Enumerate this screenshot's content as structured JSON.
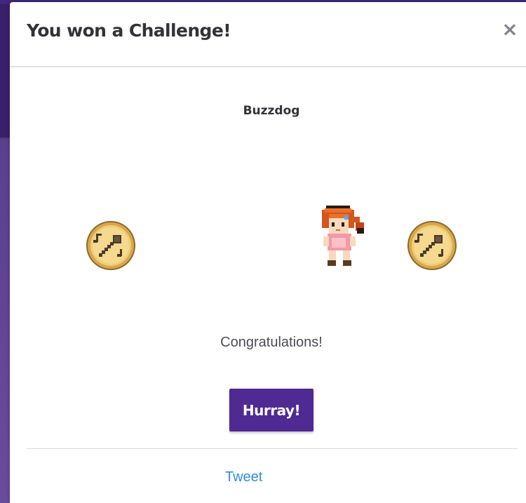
{
  "modal": {
    "title": "You won a Challenge!",
    "close_label": "×",
    "challenge_name": "Buzzdog",
    "message": "Congratulations!",
    "primary_button_label": "Hurray!",
    "tweet_label": "Tweet"
  },
  "icons": {
    "medal": "challenge-medal-microphone-icon",
    "avatar": "pixel-avatar-character",
    "close": "close-icon"
  },
  "colors": {
    "accent": "#4f2a93",
    "link": "#2e8ce6",
    "medal_gold": "#e9c26a",
    "backdrop": "#3a1f6b"
  }
}
